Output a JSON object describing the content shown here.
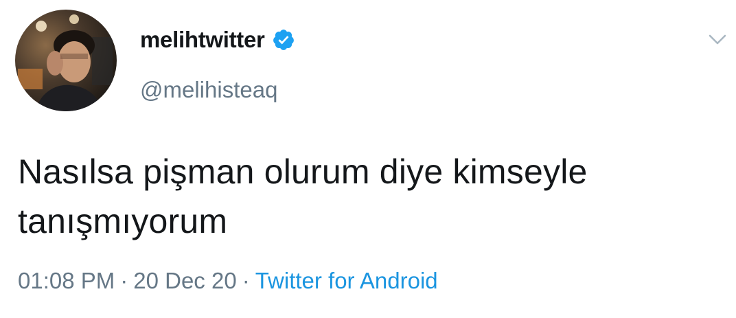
{
  "user": {
    "display_name": "melihtwitter",
    "handle": "@melihisteaq",
    "verified": true,
    "verified_icon": "verified-badge-icon"
  },
  "tweet": {
    "text_line1": "Nasılsa pişman olurum diye kimseyle",
    "text_line2": "tanışmıyorum"
  },
  "meta": {
    "time": "01:08 PM",
    "separator": "·",
    "date": "20 Dec 20",
    "source": "Twitter for Android"
  },
  "icons": {
    "menu": "chevron-down-icon",
    "avatar": "avatar"
  },
  "colors": {
    "verified_blue": "#1da1f2",
    "source_link": "#1b95e0",
    "secondary_text": "#657786",
    "primary_text": "#14171a"
  }
}
